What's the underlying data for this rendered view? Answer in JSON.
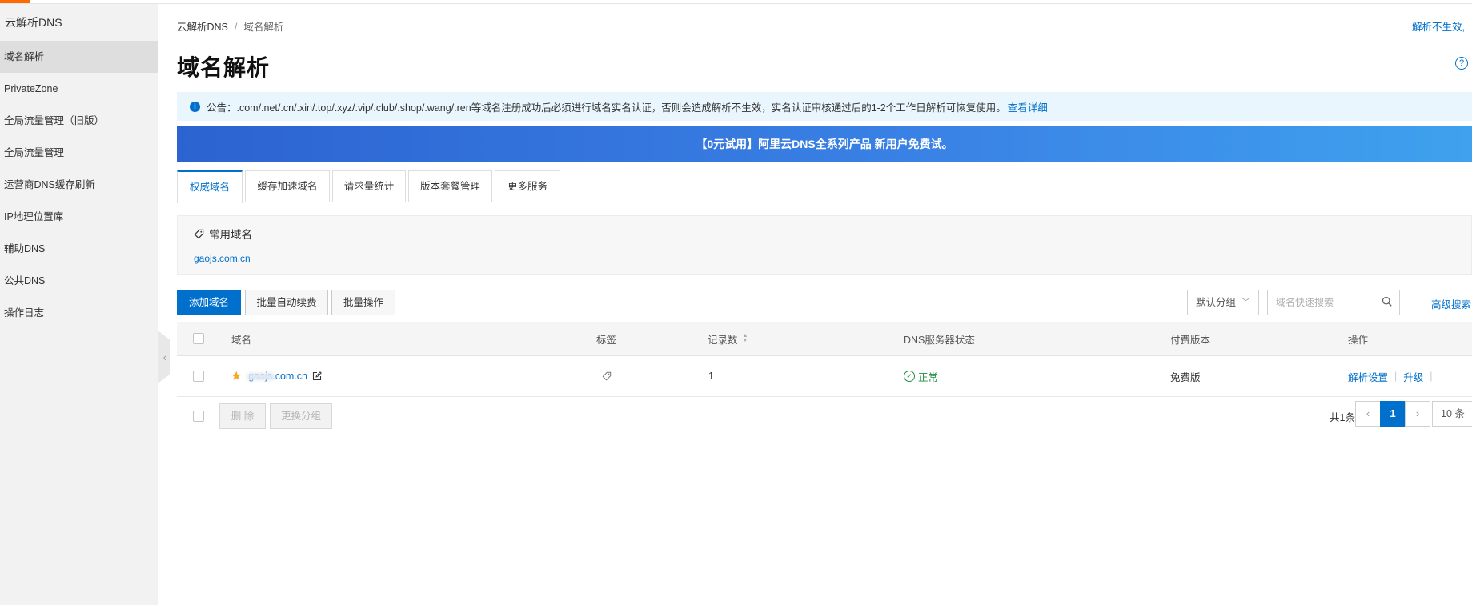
{
  "sidebar": {
    "title": "云解析DNS",
    "items": [
      {
        "label": "域名解析",
        "active": true
      },
      {
        "label": "PrivateZone"
      },
      {
        "label": "全局流量管理（旧版）"
      },
      {
        "label": "全局流量管理"
      },
      {
        "label": "运营商DNS缓存刷新"
      },
      {
        "label": "IP地理位置库"
      },
      {
        "label": "辅助DNS"
      },
      {
        "label": "公共DNS"
      },
      {
        "label": "操作日志"
      }
    ]
  },
  "breadcrumb": {
    "root": "云解析DNS",
    "sep": "/",
    "current": "域名解析"
  },
  "help_link": "解析不生效,",
  "page_title": "域名解析",
  "notice": {
    "text": "公告：.com/.net/.cn/.xin/.top/.xyz/.vip/.club/.shop/.wang/.ren等域名注册成功后必须进行域名实名认证，否则会造成解析不生效，实名认证审核通过后的1-2个工作日解析可恢复使用。",
    "link": "查看详细"
  },
  "banner": "【0元试用】阿里云DNS全系列产品 新用户免费试。",
  "tabs": [
    "权威域名",
    "缓存加速域名",
    "请求量统计",
    "版本套餐管理",
    "更多服务"
  ],
  "common_domains": {
    "heading": "常用域名",
    "domain": "gaojs.com.cn"
  },
  "toolbar": {
    "add": "添加域名",
    "auto_renew": "批量自动续费",
    "batch": "批量操作",
    "group_select": "默认分组",
    "search_placeholder": "域名快速搜索",
    "advanced": "高级搜索"
  },
  "table": {
    "headers": {
      "domain": "域名",
      "tag": "标签",
      "records": "记录数",
      "dns_status": "DNS服务器状态",
      "edition": "付费版本",
      "ops": "操作"
    },
    "rows": [
      {
        "domain": "gaojs.com.cn",
        "records": "1",
        "status": "正常",
        "edition": "免费版",
        "op_resolve": "解析设置",
        "op_upgrade": "升级"
      }
    ]
  },
  "footer": {
    "delete": "删 除",
    "change_group": "更换分组",
    "total": "共1条",
    "page": "1",
    "page_size": "10 条"
  },
  "colors": {
    "accent": "#0070cc",
    "brand": "#ff6a00",
    "ok": "#1e8e3e"
  }
}
